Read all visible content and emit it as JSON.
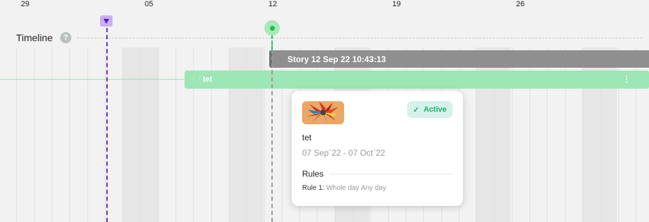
{
  "header": {
    "dates": [
      "29",
      "05",
      "12",
      "19",
      "26"
    ]
  },
  "timeline": {
    "title": "Timeline",
    "help_icon_label": "?"
  },
  "story_bar": {
    "label": "Story 12 Sep 22 10:43:13"
  },
  "campaign_bar": {
    "label": "tet",
    "menu_icon": "⋮",
    "drag_icon": "⋮⋮"
  },
  "card": {
    "status": "Active",
    "status_icon": "✓",
    "title": "tet",
    "dates": "07 Sep`22 - 07 Oct`22",
    "rules_title": "Rules",
    "rule_label": "Rule 1:",
    "rule_value": "Whole day Any day"
  },
  "colors": {
    "today_marker": "#6a2ad0",
    "story_marker": "#19c24a",
    "campaign_bar": "#9ce7b3",
    "story_bar": "#8f8f8f",
    "status_active": "#19b26a"
  }
}
